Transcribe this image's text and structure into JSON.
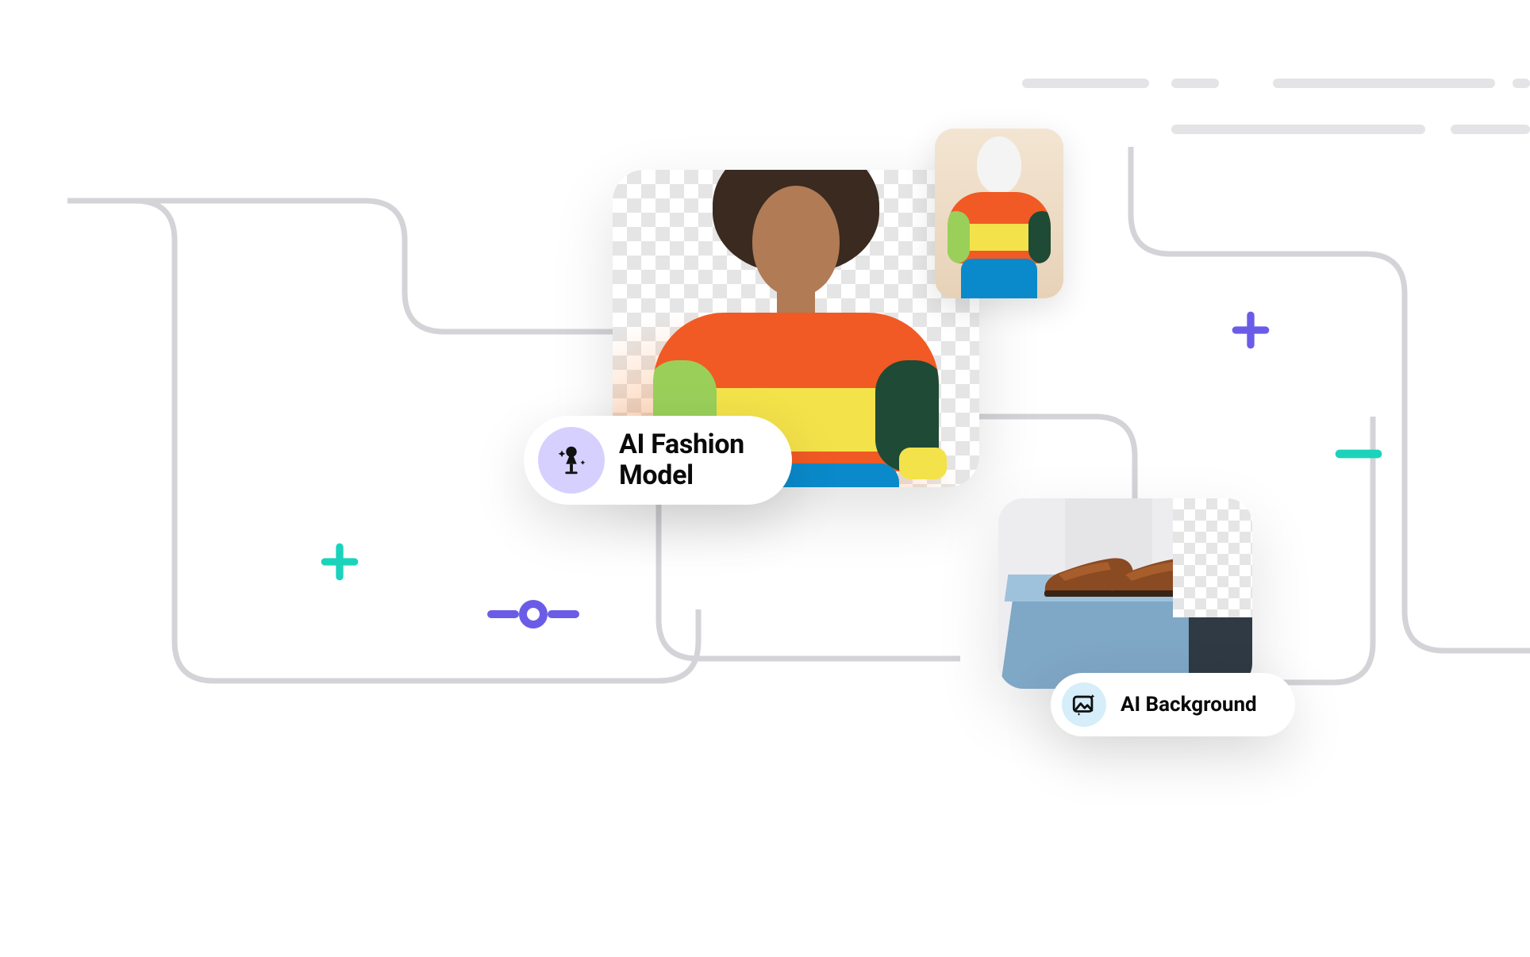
{
  "pills": {
    "fashion": {
      "label_line1": "AI Fashion",
      "label_line2": "Model",
      "icon": "mannequin-sparkle-icon"
    },
    "background": {
      "label": "AI Background",
      "icon": "image-sparkle-icon"
    }
  },
  "colors": {
    "accent_purple": "#6b5ce7",
    "accent_teal": "#1bd3bb",
    "line_gray": "#d4d4d8",
    "pill_purple_bg": "#d6d0ff",
    "pill_blue_bg": "#d5eef9"
  },
  "glyphs": {
    "plus_purple": "plus-icon",
    "plus_teal": "plus-icon",
    "minus_teal": "minus-icon",
    "commit_node": "commit-node-icon"
  },
  "cards": {
    "fashion_model": "ai-fashion-model-card",
    "mannequin_thumb": "mannequin-thumb-card",
    "shoes": "ai-background-shoes-card"
  }
}
